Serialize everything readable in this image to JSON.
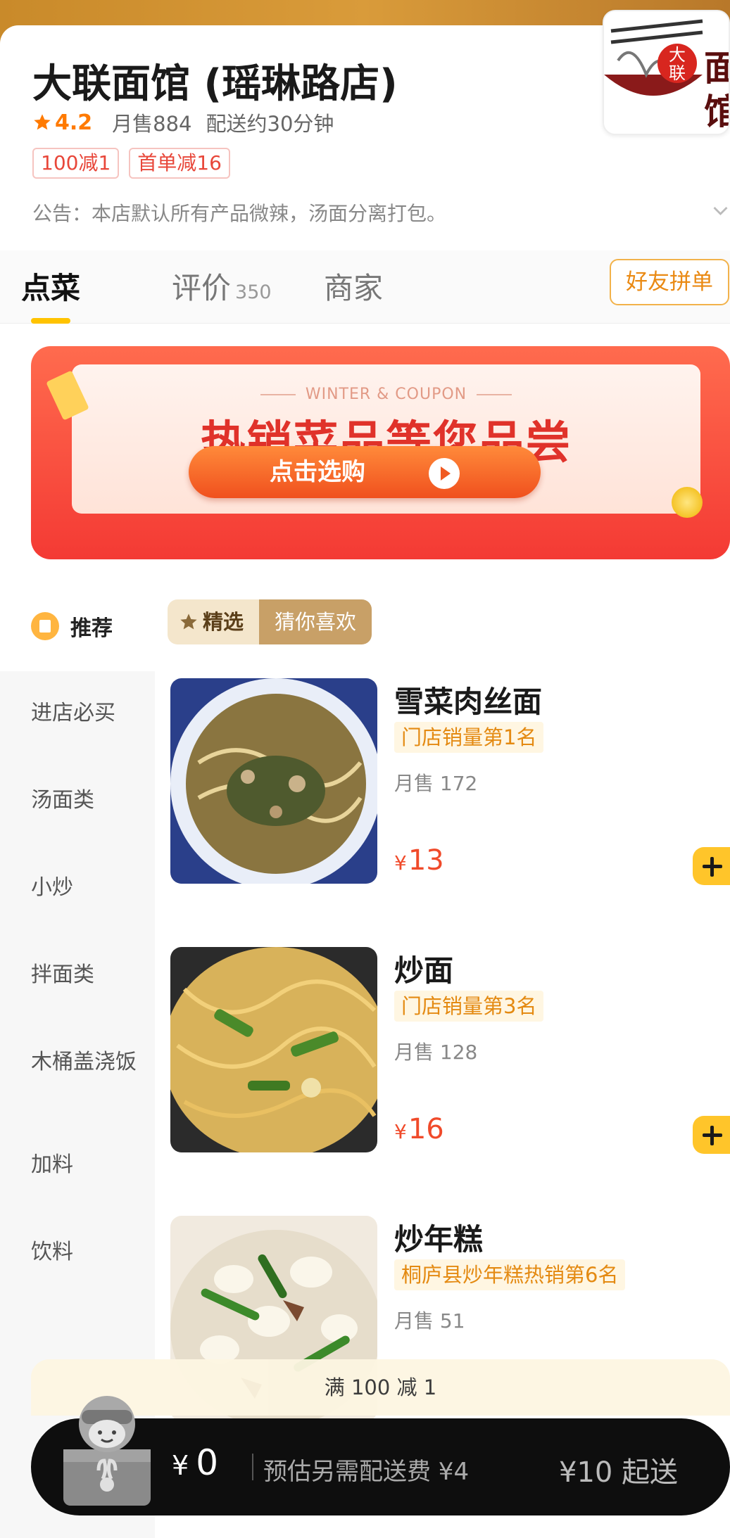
{
  "shop": {
    "name": "大联面馆 (瑶琳路店)",
    "rating": "4.2",
    "monthly_sales": "月售884",
    "delivery_time": "配送约30分钟",
    "coupons": [
      "100减1",
      "首单减16"
    ],
    "notice": "公告：本店默认所有产品微辣，汤面分离打包。",
    "logo": {
      "line1": "大",
      "line2": "联",
      "big_char": "面",
      "big_char2": "馆"
    }
  },
  "tabs": [
    {
      "label": "点菜",
      "count": ""
    },
    {
      "label": "评价",
      "count": "350"
    },
    {
      "label": "商家",
      "count": ""
    }
  ],
  "group_order_label": "好友拼单",
  "banner": {
    "subtitle": "WINTER & COUPON",
    "title": "热销菜品等您品尝",
    "button_label": "点击选购"
  },
  "recommend_label": "推荐",
  "filters": {
    "selected": "精选",
    "other": "猜你喜欢"
  },
  "categories": [
    "进店必买",
    "汤面类",
    "小炒",
    "拌面类",
    "木桶盖浇饭",
    "加料",
    "饮料"
  ],
  "products": [
    {
      "name": "雪菜肉丝面",
      "rank": "门店销量第1名",
      "sales": "月售 172",
      "price": "13",
      "currency": "¥"
    },
    {
      "name": "炒面",
      "rank": "门店销量第3名",
      "sales": "月售 128",
      "price": "16",
      "currency": "¥"
    },
    {
      "name": "炒年糕",
      "rank": "桐庐县炒年糕热销第6名",
      "sales": "月售 51",
      "price": "",
      "currency": ""
    }
  ],
  "promo_strip": "满 100 减 1",
  "cart": {
    "currency": "¥",
    "amount": "0",
    "delivery_fee_note": "预估另需配送费 ¥4",
    "min_order": "¥10 起送"
  },
  "colors": {
    "accent_yellow": "#ffc300",
    "price_red": "#f04a2a",
    "rank_orange": "#e48a12",
    "banner_red": "#f43a34"
  }
}
